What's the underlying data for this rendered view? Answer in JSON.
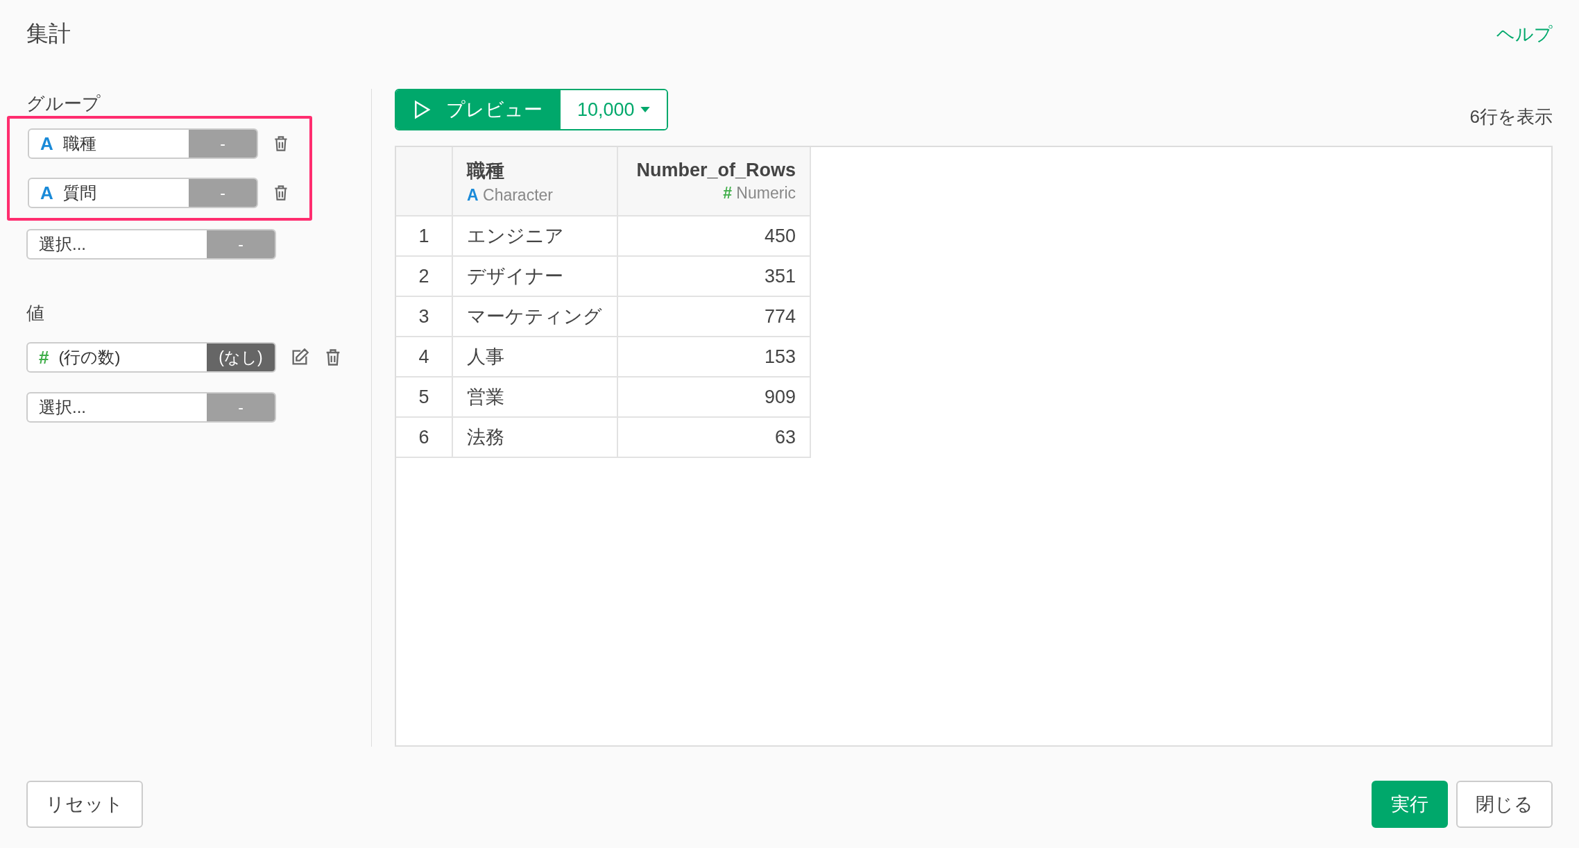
{
  "title": "集計",
  "help_link": "ヘルプ",
  "group": {
    "label": "グループ",
    "highlighted": true,
    "fields": [
      {
        "kind": "character",
        "icon": "A",
        "name": "職種",
        "aggregation": "-",
        "active": false,
        "editable": false,
        "removable": true
      },
      {
        "kind": "character",
        "icon": "A",
        "name": "質問",
        "aggregation": "-",
        "active": false,
        "editable": false,
        "removable": true
      },
      {
        "kind": "empty",
        "placeholder": "選択...",
        "aggregation": "-",
        "active": false,
        "editable": false,
        "removable": false
      }
    ]
  },
  "values": {
    "label": "値",
    "fields": [
      {
        "kind": "numeric",
        "icon": "#",
        "name": "(行の数)",
        "aggregation": "(なし)",
        "active": true,
        "editable": true,
        "removable": true
      },
      {
        "kind": "empty",
        "placeholder": "選択...",
        "aggregation": "-",
        "active": false,
        "editable": false,
        "removable": false
      }
    ]
  },
  "preview": {
    "button": "プレビュー",
    "row_limit": "10,000",
    "row_count": "6行を表示"
  },
  "table": {
    "columns": [
      {
        "name": "職種",
        "kind": "character",
        "type_icon": "A",
        "type": "Character"
      },
      {
        "name": "Number_of_Rows",
        "kind": "numeric",
        "type_icon": "#",
        "type": "Numeric"
      }
    ],
    "rows": [
      {
        "index": "1",
        "cells": [
          "エンジニア",
          "450"
        ]
      },
      {
        "index": "2",
        "cells": [
          "デザイナー",
          "351"
        ]
      },
      {
        "index": "3",
        "cells": [
          "マーケティング",
          "774"
        ]
      },
      {
        "index": "4",
        "cells": [
          "人事",
          "153"
        ]
      },
      {
        "index": "5",
        "cells": [
          "営業",
          "909"
        ]
      },
      {
        "index": "6",
        "cells": [
          "法務",
          "63"
        ]
      }
    ]
  },
  "footer": {
    "reset": "リセット",
    "run": "実行",
    "close": "閉じる"
  }
}
